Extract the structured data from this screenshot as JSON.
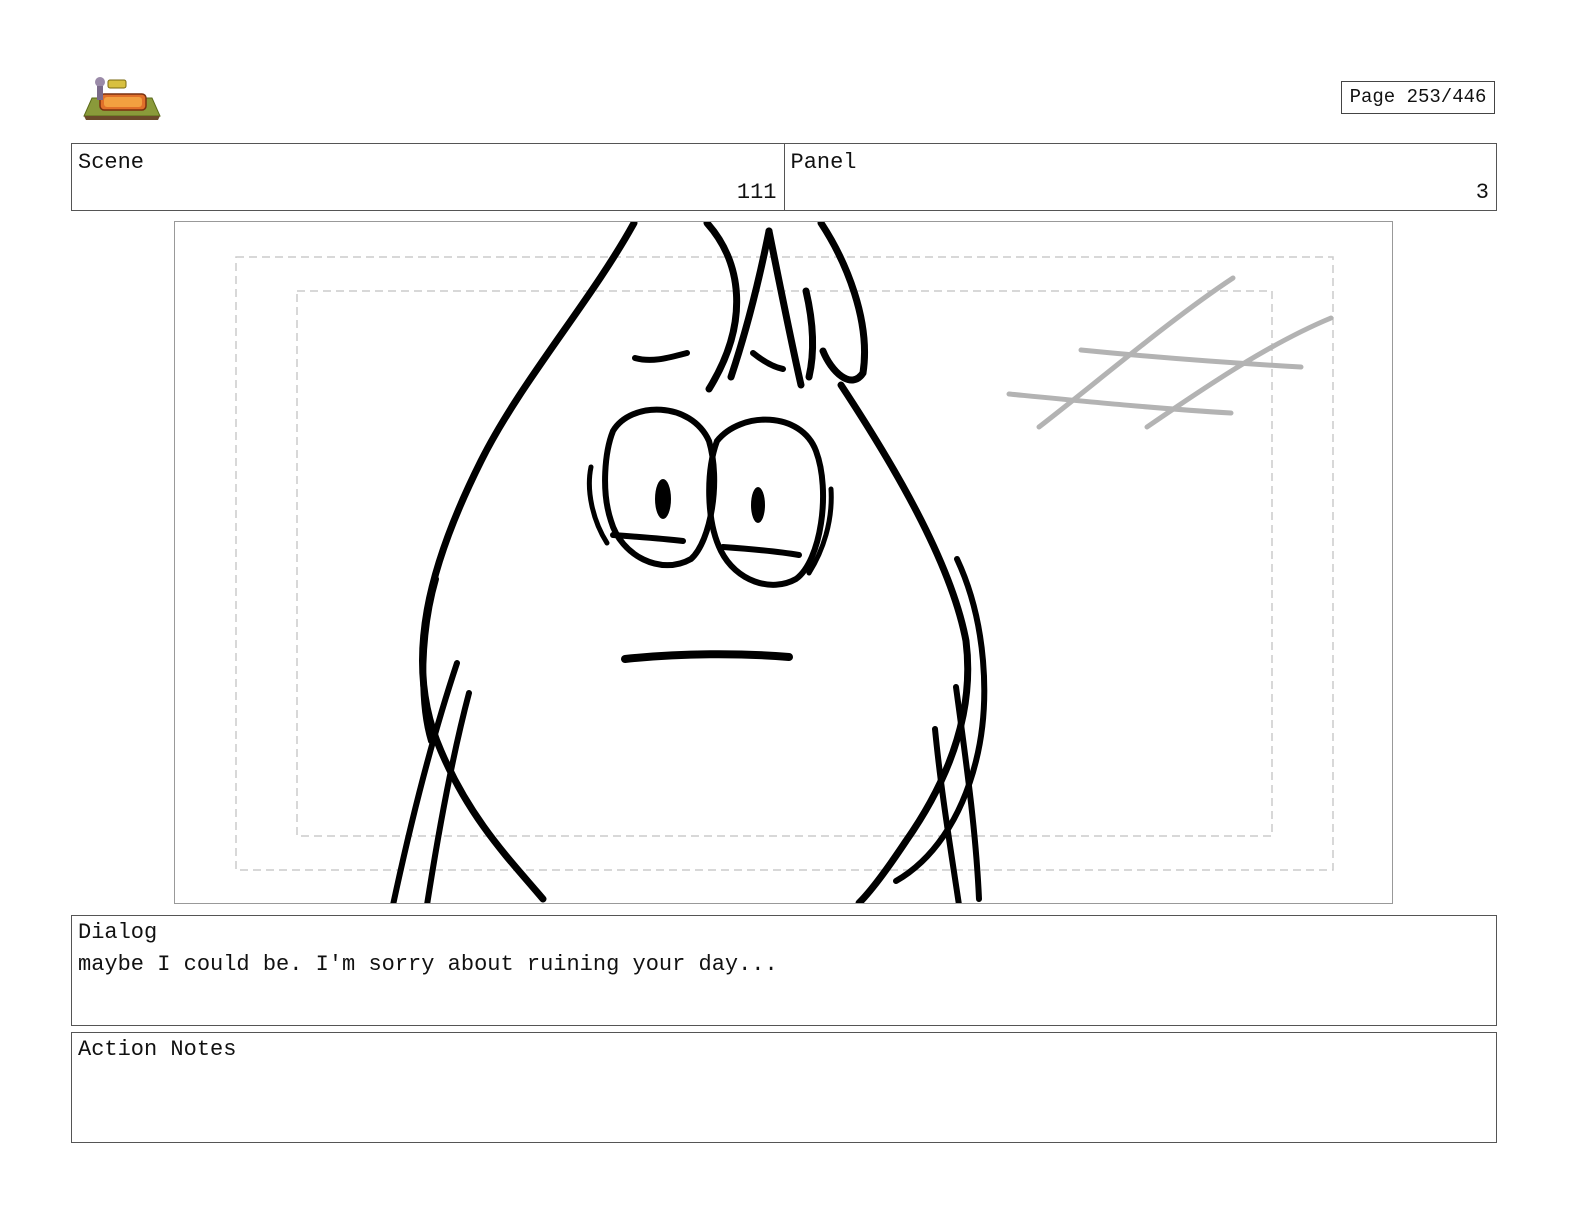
{
  "header": {
    "logo_icon": "show-logo-icon",
    "page_label": "Page 253/446"
  },
  "scene": {
    "label": "Scene",
    "value": "111"
  },
  "panel": {
    "label": "Panel",
    "value": "3"
  },
  "artwork": {
    "subject": "storyboard-sketch-character-face",
    "line_color": "#000000",
    "safe_frame_color": "#cccccc",
    "window_color": "#b3b3b3"
  },
  "dialog": {
    "label": "Dialog",
    "text": "maybe I could be. I'm sorry about ruining your day..."
  },
  "action_notes": {
    "label": "Action Notes",
    "text": ""
  }
}
